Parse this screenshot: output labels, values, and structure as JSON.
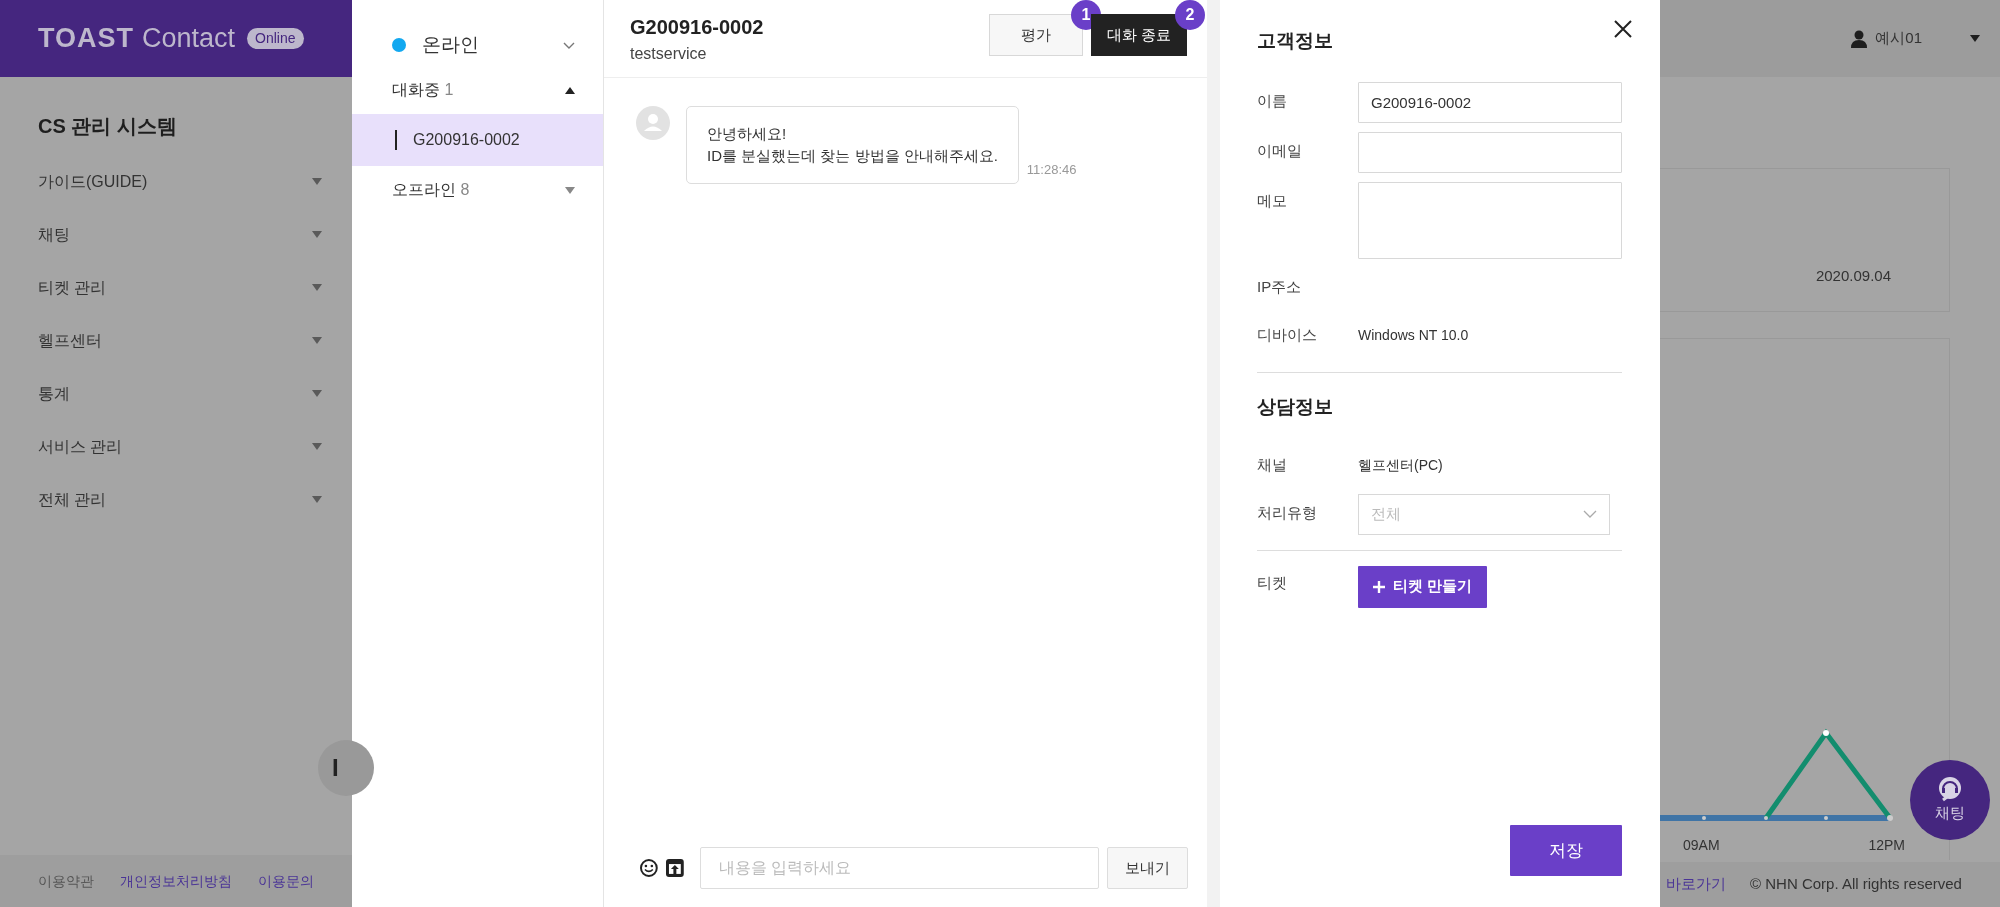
{
  "app": {
    "logo": {
      "brand": "TOAST",
      "product": "Contact",
      "badge": "Online"
    },
    "sidebar": {
      "title": "CS 관리 시스템",
      "items": [
        {
          "label": "가이드(GUIDE)",
          "expanded": false
        },
        {
          "label": "채팅",
          "expanded": false
        },
        {
          "label": "티켓 관리",
          "expanded": false
        },
        {
          "label": "헬프센터",
          "expanded": false
        },
        {
          "label": "통계",
          "expanded": false
        },
        {
          "label": "서비스 관리",
          "expanded": false
        },
        {
          "label": "전체 관리",
          "expanded": false
        }
      ]
    },
    "floating_badge": "I",
    "user": {
      "name": "예시01"
    },
    "summary_card": {
      "date": "2020.09.04"
    },
    "chart": {
      "x_labels": [
        "09AM",
        "12PM"
      ]
    },
    "chat_fab": {
      "label": "채팅"
    },
    "footer": {
      "links": [
        {
          "label": "이용약관",
          "kind": "plain"
        },
        {
          "label": "개인정보처리방침",
          "kind": "link"
        },
        {
          "label": "이용문의",
          "kind": "link"
        }
      ],
      "shortcut": "바로가기",
      "copyright": "© NHN Corp. All rights reserved"
    }
  },
  "chat_list": {
    "status": {
      "label": "온라인"
    },
    "groups": [
      {
        "label": "대화중",
        "count": "1",
        "expanded": true,
        "children": [
          {
            "label": "G200916-0002",
            "selected": true
          }
        ]
      },
      {
        "label": "오프라인",
        "count": "8",
        "expanded": false
      }
    ]
  },
  "chat": {
    "title": "G200916-0002",
    "subtitle": "testservice",
    "actions": [
      {
        "label": "평가",
        "kind": "outline",
        "step": "1"
      },
      {
        "label": "대화 종료",
        "kind": "dark",
        "step": "2"
      }
    ],
    "messages": [
      {
        "lines": [
          "안녕하세요!",
          "ID를 분실했는데 찾는 방법을 안내해주세요."
        ],
        "time": "11:28:46"
      }
    ],
    "composer": {
      "placeholder": "내용을 입력하세요",
      "send": "보내기"
    }
  },
  "customer_panel": {
    "title": "고객정보",
    "fields": [
      {
        "label": "이름",
        "kind": "input",
        "value": "G200916-0002"
      },
      {
        "label": "이메일",
        "kind": "input"
      },
      {
        "label": "메모",
        "kind": "textarea"
      },
      {
        "label": "IP주소",
        "kind": "text"
      },
      {
        "label": "디바이스",
        "kind": "text",
        "value": "Windows NT 10.0"
      }
    ],
    "consult_title": "상담정보",
    "consult_fields": [
      {
        "label": "채널",
        "kind": "text",
        "value": "헬프센터(PC)"
      },
      {
        "label": "처리유형",
        "kind": "select",
        "placeholder": "전체"
      }
    ],
    "ticket": {
      "label": "티켓",
      "button": "티켓 만들기"
    },
    "save": "저장"
  }
}
